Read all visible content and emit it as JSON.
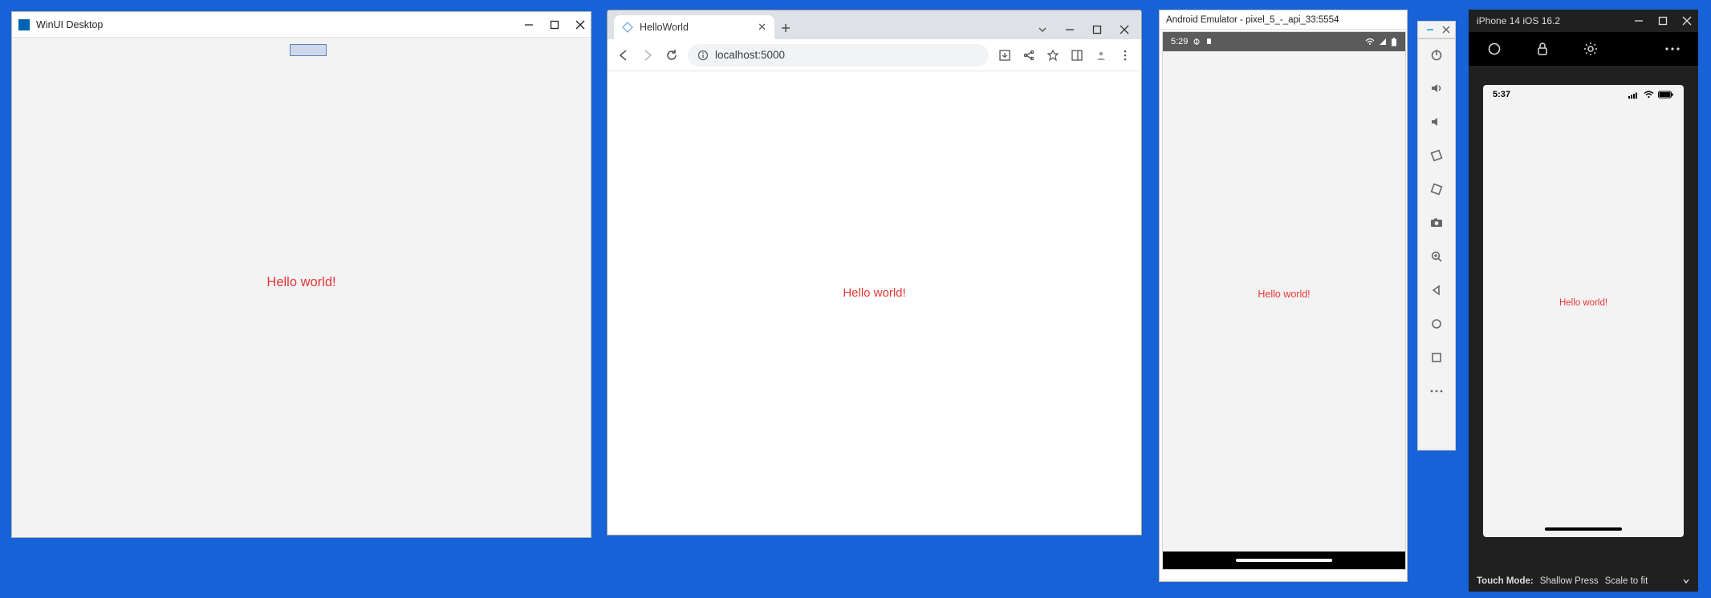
{
  "winui": {
    "title": "WinUI Desktop",
    "content": "Hello world!"
  },
  "browser": {
    "tab_title": "HelloWorld",
    "url": "localhost:5000",
    "content": "Hello world!"
  },
  "android": {
    "title": "Android Emulator - pixel_5_-_api_33:5554",
    "status_time": "5:29",
    "content": "Hello world!"
  },
  "ios": {
    "title": "iPhone 14 iOS 16.2",
    "status_time": "5:37",
    "content": "Hello world!",
    "footer_label": "Touch Mode:",
    "footer_mode": "Shallow Press",
    "footer_scale": "Scale to fit"
  }
}
